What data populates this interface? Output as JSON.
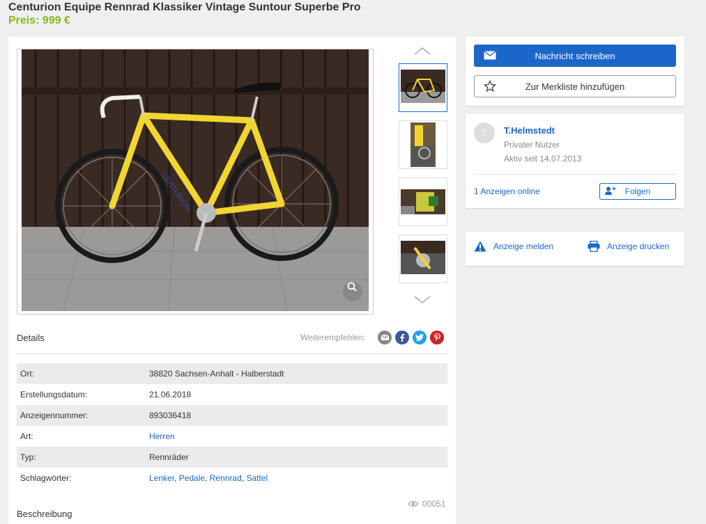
{
  "listing": {
    "title": "Centurion Equipe Rennrad Klassiker Vintage Suntour Superbe Pro",
    "price": "Preis: 999 €"
  },
  "gallery": {
    "zoom_icon": "magnifier-icon",
    "thumb_count": 4,
    "active_thumb": 1
  },
  "details": {
    "heading": "Details",
    "share_label": "Weiterempfehlen:",
    "share_icons": [
      "email-icon",
      "facebook-icon",
      "twitter-icon",
      "pinterest-icon"
    ],
    "rows": [
      {
        "label": "Ort:",
        "value": "38820 Sachsen-Anhalt - Halberstadt"
      },
      {
        "label": "Erstellungsdatum:",
        "value": "21.06.2018"
      },
      {
        "label": "Anzeigennummer:",
        "value": "893036418"
      },
      {
        "label": "Art:",
        "value": "Herren"
      },
      {
        "label": "Typ:",
        "value": "Rennräder"
      },
      {
        "label": "Schlagwörter:",
        "tags": [
          "Lenker",
          "Pedale",
          "Rennrad",
          "Sattel"
        ]
      }
    ],
    "views": "00051",
    "description_heading": "Beschreibung"
  },
  "contact": {
    "message_button": "Nachricht schreiben",
    "watchlist_button": "Zur Merkliste hinzufügen"
  },
  "seller": {
    "avatar_letter": "T",
    "name": "T.Helmstedt",
    "type": "Privater Nutzer",
    "active_since": "Aktiv seit 14.07.2013",
    "ads_online": "1 Anzeigen online",
    "follow_button": "Folgen"
  },
  "actions": {
    "report": "Anzeige melden",
    "print": "Anzeige drucken"
  },
  "colors": {
    "accent": "#1b66c9",
    "price": "#86b817",
    "bike_frame": "#f2d531"
  }
}
